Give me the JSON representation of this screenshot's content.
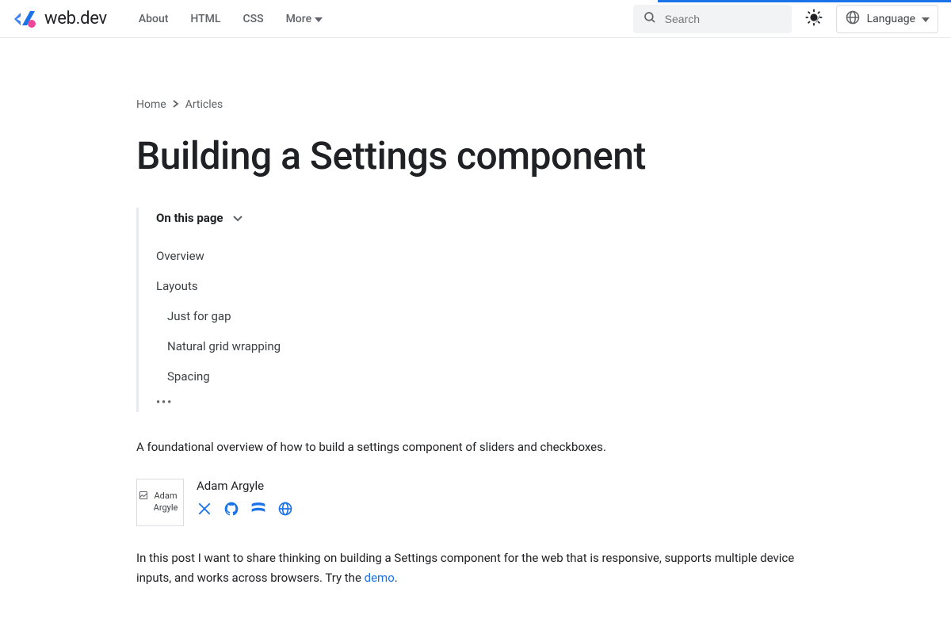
{
  "site": {
    "name": "web.dev"
  },
  "nav": {
    "items": [
      {
        "label": "About"
      },
      {
        "label": "HTML"
      },
      {
        "label": "CSS"
      }
    ],
    "more": "More"
  },
  "search": {
    "placeholder": "Search",
    "shortcut": "/"
  },
  "language": {
    "label": "Language"
  },
  "breadcrumb": {
    "home": "Home",
    "articles": "Articles"
  },
  "article": {
    "title": "Building a Settings component",
    "lede": "A foundational overview of how to build a settings component of sliders and checkboxes.",
    "intro_pre": "In this post I want to share thinking on building a Settings component for the web that is responsive, supports multiple device inputs, and works across browsers. Try the ",
    "intro_link": "demo",
    "intro_post": "."
  },
  "toc": {
    "header": "On this page",
    "items": [
      {
        "label": "Overview",
        "sub": false
      },
      {
        "label": "Layouts",
        "sub": false
      },
      {
        "label": "Just for gap",
        "sub": true
      },
      {
        "label": "Natural grid wrapping",
        "sub": true
      },
      {
        "label": "Spacing",
        "sub": true
      }
    ],
    "more": "•••"
  },
  "author": {
    "name": "Adam Argyle",
    "avatar_alt": "Adam Argyle"
  },
  "colors": {
    "link": "#1a73e8"
  }
}
